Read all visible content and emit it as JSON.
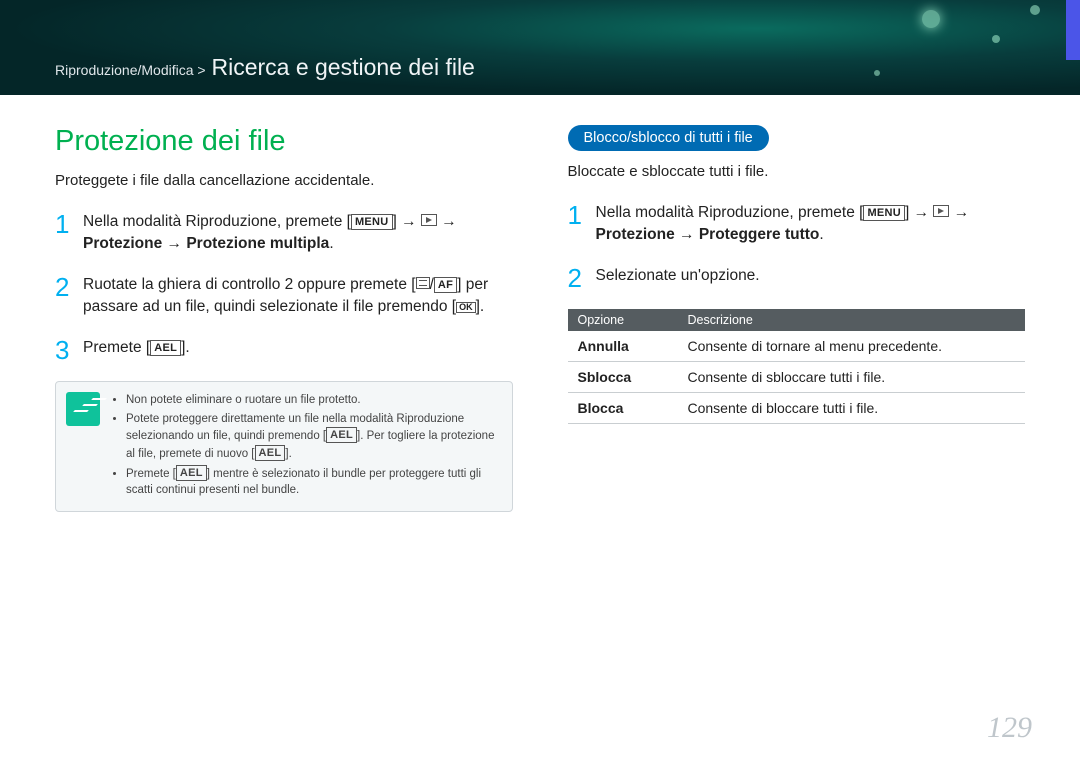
{
  "header": {
    "breadcrumb_prefix": "Riproduzione/Modifica >",
    "section_title": "Ricerca e gestione dei file"
  },
  "left": {
    "heading": "Protezione dei file",
    "intro": "Proteggete i file dalla cancellazione accidentale.",
    "steps": {
      "s1_pre": "Nella modalità Riproduzione, premete [",
      "s1_mid": "] → ",
      "s1_post": " → ",
      "s1_bold": "Protezione → Protezione multipla",
      "s1_end": ".",
      "s2_pre": "Ruotate la ghiera di controllo 2 oppure premete [",
      "s2_mid": "/",
      "s2_post": "] per passare ad un file, quindi selezionate il file premendo [",
      "s2_end": "].",
      "s3_pre": "Premete [",
      "s3_end": "]."
    },
    "labels": {
      "menu": "MENU",
      "af": "AF",
      "ael": "AEL",
      "ok": "OK"
    },
    "notes": {
      "n1": "Non potete eliminare o ruotare un file protetto.",
      "n2a": "Potete proteggere direttamente un file nella modalità Riproduzione selezionando un file, quindi premendo [",
      "n2b": "]. Per togliere la protezione al file, premete di nuovo [",
      "n2c": "].",
      "n3a": "Premete [",
      "n3b": "] mentre è selezionato il bundle per proteggere tutti gli scatti continui presenti nel bundle."
    }
  },
  "right": {
    "pill": "Blocco/sblocco di tutti i file",
    "intro": "Bloccate e sbloccate tutti i file.",
    "steps": {
      "s1_pre": "Nella modalità Riproduzione, premete [",
      "s1_mid": "] → ",
      "s1_post": " → ",
      "s1_bold": "Protezione → Proteggere tutto",
      "s1_end": ".",
      "s2": "Selezionate un'opzione."
    },
    "table": {
      "h1": "Opzione",
      "h2": "Descrizione",
      "rows": [
        {
          "opt": "Annulla",
          "desc": "Consente di tornare al menu precedente."
        },
        {
          "opt": "Sblocca",
          "desc": "Consente di sbloccare tutti i file."
        },
        {
          "opt": "Blocca",
          "desc": "Consente di bloccare tutti i file."
        }
      ]
    }
  },
  "page_number": "129"
}
